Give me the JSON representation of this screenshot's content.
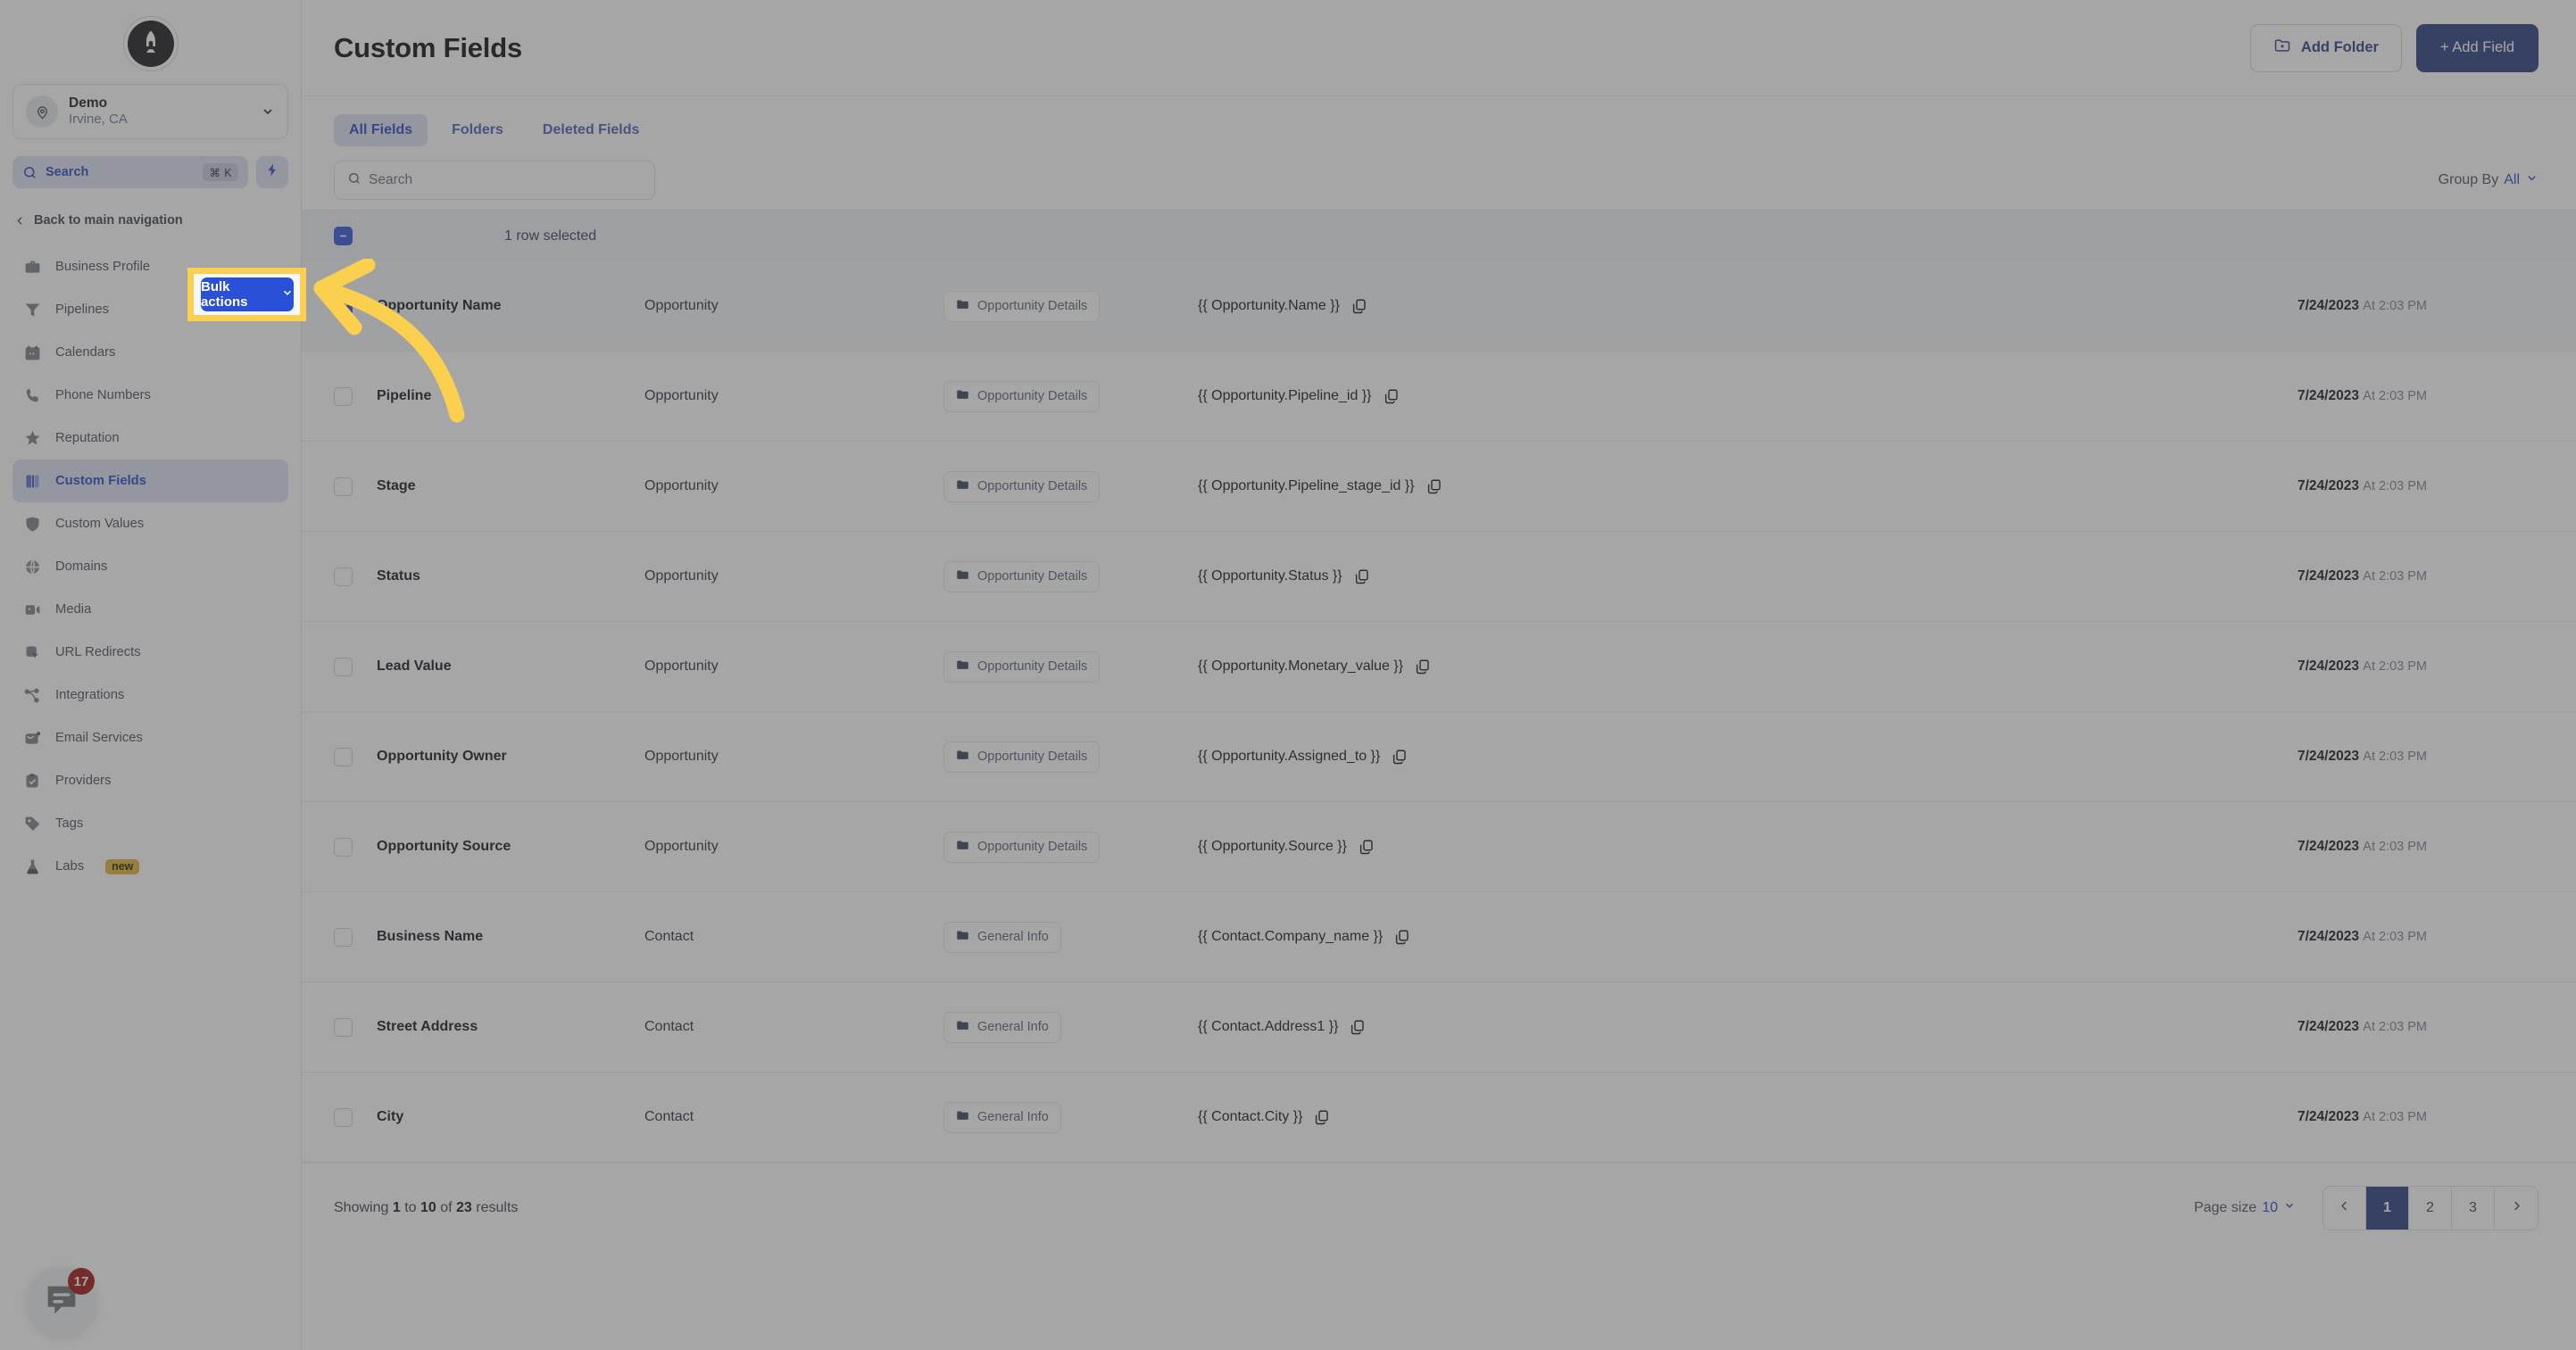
{
  "sidebar": {
    "logo_icon": "rocket-logo-icon",
    "location": {
      "name": "Demo",
      "sub": "Irvine, CA",
      "avatar_icon": "location-pin-icon",
      "chevron_icon": "chevron-down-icon"
    },
    "search": {
      "label": "Search",
      "shortcut": "⌘ K",
      "icon": "search-icon"
    },
    "quick_action_icon": "lightning-bolt-icon",
    "back_label": "Back to main navigation",
    "back_icon": "chevron-left-icon",
    "items": [
      {
        "label": "Business Profile",
        "icon": "briefcase-icon",
        "active": false
      },
      {
        "label": "Pipelines",
        "icon": "funnel-icon",
        "active": false
      },
      {
        "label": "Calendars",
        "icon": "calendar-icon",
        "active": false
      },
      {
        "label": "Phone Numbers",
        "icon": "phone-icon",
        "active": false
      },
      {
        "label": "Reputation",
        "icon": "star-icon",
        "active": false
      },
      {
        "label": "Custom Fields",
        "icon": "columns-icon",
        "active": true
      },
      {
        "label": "Custom Values",
        "icon": "shield-icon",
        "active": false
      },
      {
        "label": "Domains",
        "icon": "globe-icon",
        "active": false
      },
      {
        "label": "Media",
        "icon": "video-icon",
        "active": false
      },
      {
        "label": "URL Redirects",
        "icon": "cursor-box-icon",
        "active": false
      },
      {
        "label": "Integrations",
        "icon": "nodes-icon",
        "active": false
      },
      {
        "label": "Email Services",
        "icon": "envelope-icon",
        "active": false
      },
      {
        "label": "Providers",
        "icon": "clipboard-check-icon",
        "active": false
      },
      {
        "label": "Tags",
        "icon": "tag-icon",
        "active": false
      },
      {
        "label": "Labs",
        "icon": "flask-icon",
        "active": false,
        "badge": "new"
      }
    ],
    "chat": {
      "icon": "chat-bubble-icon",
      "count": "17"
    }
  },
  "header": {
    "title": "Custom Fields",
    "add_folder_label": "Add Folder",
    "add_folder_icon": "folder-plus-icon",
    "add_field_label": "+ Add Field"
  },
  "tabs": [
    {
      "label": "All Fields",
      "active": true
    },
    {
      "label": "Folders",
      "active": false
    },
    {
      "label": "Deleted Fields",
      "active": false
    }
  ],
  "toolbar": {
    "search_placeholder": "Search",
    "search_value": "",
    "search_icon": "search-icon",
    "group_by_label": "Group By",
    "group_by_value": "All",
    "group_by_icon": "chevron-down-icon"
  },
  "bulkbar": {
    "selected_text": "1 row selected",
    "bulk_actions_label": "Bulk actions",
    "bulk_actions_icon": "chevron-down-icon"
  },
  "table": {
    "rows": [
      {
        "name": "Opportunity Name",
        "object": "Opportunity",
        "folder": "Opportunity Details",
        "key": "{{ Opportunity.Name }}",
        "date": "7/24/2023",
        "time": "At 2:03 PM",
        "selected": true
      },
      {
        "name": "Pipeline",
        "object": "Opportunity",
        "folder": "Opportunity Details",
        "key": "{{ Opportunity.Pipeline_id }}",
        "date": "7/24/2023",
        "time": "At 2:03 PM",
        "selected": false
      },
      {
        "name": "Stage",
        "object": "Opportunity",
        "folder": "Opportunity Details",
        "key": "{{ Opportunity.Pipeline_stage_id }}",
        "date": "7/24/2023",
        "time": "At 2:03 PM",
        "selected": false
      },
      {
        "name": "Status",
        "object": "Opportunity",
        "folder": "Opportunity Details",
        "key": "{{ Opportunity.Status }}",
        "date": "7/24/2023",
        "time": "At 2:03 PM",
        "selected": false
      },
      {
        "name": "Lead Value",
        "object": "Opportunity",
        "folder": "Opportunity Details",
        "key": "{{ Opportunity.Monetary_value }}",
        "date": "7/24/2023",
        "time": "At 2:03 PM",
        "selected": false
      },
      {
        "name": "Opportunity Owner",
        "object": "Opportunity",
        "folder": "Opportunity Details",
        "key": "{{ Opportunity.Assigned_to }}",
        "date": "7/24/2023",
        "time": "At 2:03 PM",
        "selected": false
      },
      {
        "name": "Opportunity Source",
        "object": "Opportunity",
        "folder": "Opportunity Details",
        "key": "{{ Opportunity.Source }}",
        "date": "7/24/2023",
        "time": "At 2:03 PM",
        "selected": false
      },
      {
        "name": "Business Name",
        "object": "Contact",
        "folder": "General Info",
        "key": "{{ Contact.Company_name }}",
        "date": "7/24/2023",
        "time": "At 2:03 PM",
        "selected": false
      },
      {
        "name": "Street Address",
        "object": "Contact",
        "folder": "General Info",
        "key": "{{ Contact.Address1 }}",
        "date": "7/24/2023",
        "time": "At 2:03 PM",
        "selected": false
      },
      {
        "name": "City",
        "object": "Contact",
        "folder": "General Info",
        "key": "{{ Contact.City }}",
        "date": "7/24/2023",
        "time": "At 2:03 PM",
        "selected": false
      }
    ]
  },
  "footer": {
    "showing_prefix": "Showing",
    "showing_from": "1",
    "showing_mid": "to",
    "showing_to": "10",
    "showing_of": "of",
    "showing_total": "23",
    "showing_suffix": "results",
    "page_size_label": "Page size",
    "page_size_value": "10",
    "pages": [
      "1",
      "2",
      "3"
    ],
    "active_page": "1",
    "prev_icon": "chevron-left-icon",
    "next_icon": "chevron-right-icon"
  },
  "annotation": {
    "arrow_color": "#fbd04f",
    "highlight_color": "#fbd04f"
  },
  "colors": {
    "accent_blue": "#2c49c2",
    "primary_navy": "#2a3f80",
    "bulk_blue": "#2b50d8",
    "highlight_yellow": "#fbd04f",
    "badge_gold": "#e2b636",
    "notify_red": "#a31515"
  }
}
